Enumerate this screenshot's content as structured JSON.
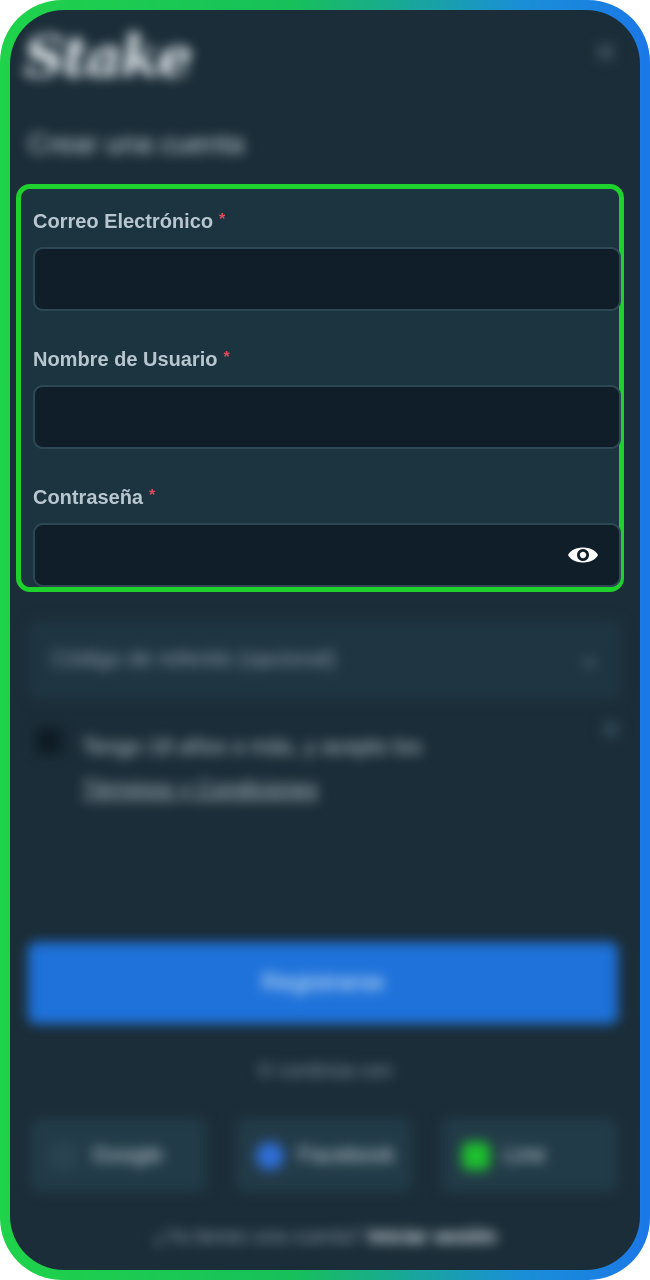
{
  "brand": {
    "logo_text": "Stake"
  },
  "header": {
    "title": "Crear una cuenta",
    "close_glyph": "✕"
  },
  "form": {
    "email_label": "Correo Electrónico",
    "email_value": "",
    "username_label": "Nombre de Usuario",
    "username_value": "",
    "password_label": "Contraseña",
    "password_value": "",
    "required_mark": "*"
  },
  "referral": {
    "label": "Código de referido (opcional)",
    "chevron": "⌄"
  },
  "terms": {
    "text_line1": "Tengo 18 años o más, y acepto los",
    "link_text": "Términos y Condiciones"
  },
  "actions": {
    "register_label": "Registrarse",
    "or_continue": "O continúa con",
    "google_label": "Google",
    "facebook_label": "Facebook",
    "line_label": "Line"
  },
  "footer": {
    "question": "¿Ya tienes una cuenta?",
    "login_label": "Iniciar sesión"
  },
  "colors": {
    "frame_green": "#1fd34a",
    "frame_blue": "#1b78e8",
    "highlight_border": "#1fd12c",
    "background": "#1b2d38",
    "panel": "#1c3340",
    "input_bg": "#0f1e29",
    "required_red": "#e24a5b",
    "register_blue": "#1e72da"
  }
}
